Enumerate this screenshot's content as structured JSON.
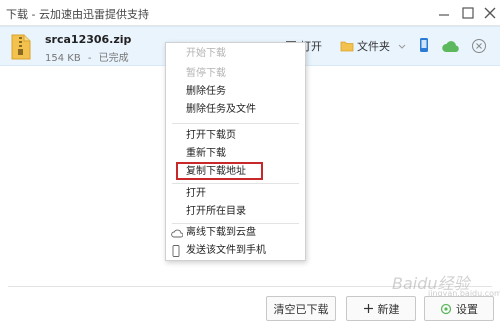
{
  "window": {
    "title": "下载 - 云加速由迅雷提供支持"
  },
  "download": {
    "file_name": "srca12306.zip",
    "size": "154 KB",
    "separator": "-",
    "status": "已完成",
    "open_label": "打开",
    "folder_label": "文件夹"
  },
  "context_menu": {
    "items": [
      {
        "label": "开始下载",
        "enabled": false
      },
      {
        "label": "暂停下载",
        "enabled": false
      },
      {
        "label": "删除任务",
        "enabled": true
      },
      {
        "label": "删除任务及文件",
        "enabled": true
      },
      {
        "label": "打开下载页",
        "enabled": true
      },
      {
        "label": "重新下载",
        "enabled": true
      },
      {
        "label": "复制下载地址",
        "enabled": true
      },
      {
        "label": "打开",
        "enabled": true
      },
      {
        "label": "打开所在目录",
        "enabled": true
      },
      {
        "label": "离线下载到云盘",
        "enabled": true
      },
      {
        "label": "发送该文件到手机",
        "enabled": true
      }
    ],
    "highlighted_item": "复制下载地址",
    "highlight_color": "#c8282a"
  },
  "footer": {
    "clear_label": "清空已下载",
    "new_label": "新建",
    "settings_label": "设置"
  },
  "watermark": {
    "text": "Baidu经验",
    "sub": "jingyan.baidu.com"
  },
  "colors": {
    "row_bg": "#eaf4fd",
    "folder_yellow": "#f2c14e",
    "cloud_green": "#5cb85c",
    "accent_blue": "#2b7bd6"
  }
}
